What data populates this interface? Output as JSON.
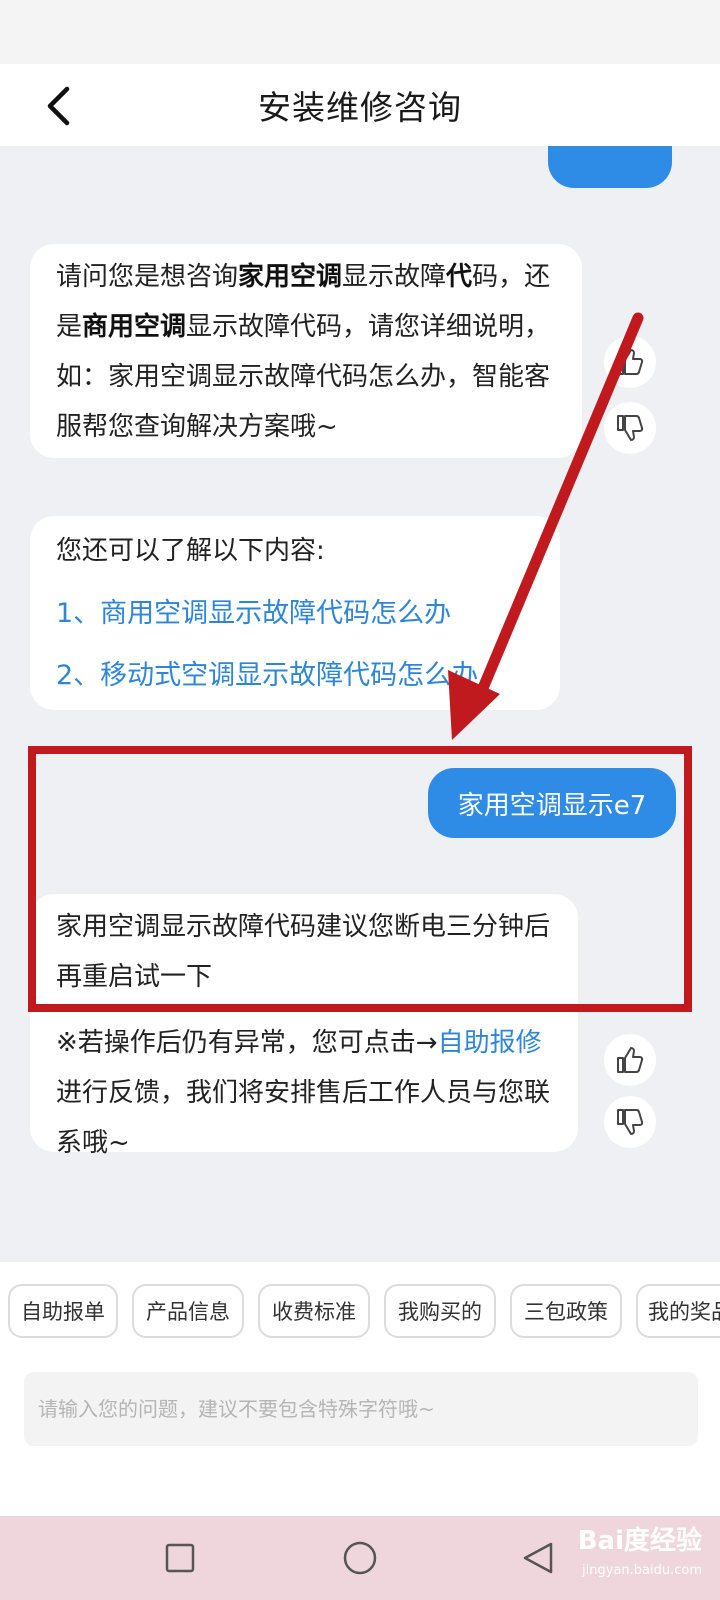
{
  "header": {
    "title": "安装维修咨询"
  },
  "messages": {
    "bot1": {
      "p1": "请问您是想咨询",
      "b1": "家用空调",
      "p2": "显示故障",
      "b2": "代",
      "p3": "码，还是",
      "b3": "商用空调",
      "p4": "显示故障代码，请您详细说明，如：家用空调显示故障代码怎么办，智能客服帮您查询解决方案哦~"
    },
    "suggest": {
      "intro": "您还可以了解以下内容:",
      "items": [
        "1、商用空调显示故障代码怎么办",
        "2、移动式空调显示故障代码怎么办"
      ]
    },
    "user": "家用空调显示e7",
    "bot2": {
      "answer": "家用空调显示故障代码建议您断电三分钟后再重启试一下",
      "note_prefix": "※若操作后仍有异常，您可点击→",
      "note_link": "自助报修",
      "note_suffix": "进行反馈，我们将安排售后工作人员与您联系哦~"
    }
  },
  "quick_replies": [
    "自助报单",
    "产品信息",
    "收费标准",
    "我购买的",
    "三包政策",
    "我的奖品"
  ],
  "input": {
    "placeholder": "请输入您的问题，建议不要包含特殊字符哦~"
  },
  "watermark": {
    "logo": "Bai度经验",
    "url": "jingyan.baidu.com"
  },
  "colors": {
    "accent": "#2f8ce6",
    "link": "#2e86d8",
    "annotation": "#c0191e"
  },
  "icons": [
    "back-arrow-icon",
    "thumbs-up-icon",
    "thumbs-down-icon",
    "square-icon",
    "circle-icon",
    "triangle-back-icon"
  ]
}
